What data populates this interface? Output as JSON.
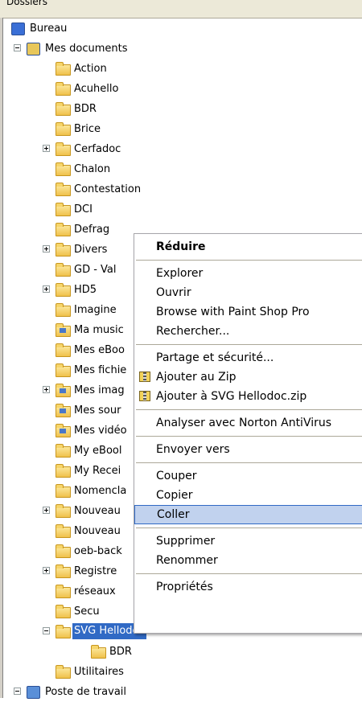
{
  "panel": {
    "title": "Dossiers"
  },
  "tree": [
    {
      "label": "Bureau",
      "icon": "desktop-icon",
      "level": 0,
      "expander": ""
    },
    {
      "label": "Mes documents",
      "icon": "my-documents-icon",
      "level": 1,
      "expander": "minus"
    },
    {
      "label": "Action",
      "icon": "folder-icon",
      "level": 2,
      "expander": ""
    },
    {
      "label": "Acuhello",
      "icon": "folder-icon",
      "level": 2,
      "expander": ""
    },
    {
      "label": "BDR",
      "icon": "folder-icon",
      "level": 2,
      "expander": ""
    },
    {
      "label": "Brice",
      "icon": "folder-icon",
      "level": 2,
      "expander": ""
    },
    {
      "label": "Cerfadoc",
      "icon": "folder-icon",
      "level": 2,
      "expander": "plus"
    },
    {
      "label": "Chalon",
      "icon": "folder-icon",
      "level": 2,
      "expander": ""
    },
    {
      "label": "Contestation",
      "icon": "folder-icon",
      "level": 2,
      "expander": ""
    },
    {
      "label": "DCI",
      "icon": "folder-icon",
      "level": 2,
      "expander": ""
    },
    {
      "label": "Defrag",
      "icon": "folder-icon",
      "level": 2,
      "expander": ""
    },
    {
      "label": "Divers",
      "icon": "folder-icon",
      "level": 2,
      "expander": "plus"
    },
    {
      "label": "GD - Val",
      "icon": "folder-icon",
      "level": 2,
      "expander": ""
    },
    {
      "label": "HD5",
      "icon": "folder-icon",
      "level": 2,
      "expander": "plus"
    },
    {
      "label": "Imagine",
      "icon": "folder-icon",
      "level": 2,
      "expander": ""
    },
    {
      "label": "Ma music",
      "icon": "music-folder-icon",
      "level": 2,
      "expander": ""
    },
    {
      "label": "Mes eBoo",
      "icon": "folder-icon",
      "level": 2,
      "expander": ""
    },
    {
      "label": "Mes fichie",
      "icon": "folder-icon",
      "level": 2,
      "expander": ""
    },
    {
      "label": "Mes imag",
      "icon": "pictures-folder-icon",
      "level": 2,
      "expander": "plus"
    },
    {
      "label": "Mes sour",
      "icon": "sources-folder-icon",
      "level": 2,
      "expander": ""
    },
    {
      "label": "Mes vidéo",
      "icon": "videos-folder-icon",
      "level": 2,
      "expander": ""
    },
    {
      "label": "My eBool",
      "icon": "folder-icon",
      "level": 2,
      "expander": ""
    },
    {
      "label": "My Recei",
      "icon": "folder-icon",
      "level": 2,
      "expander": ""
    },
    {
      "label": "Nomencla",
      "icon": "folder-icon",
      "level": 2,
      "expander": ""
    },
    {
      "label": "Nouveau",
      "icon": "folder-icon",
      "level": 2,
      "expander": "plus"
    },
    {
      "label": "Nouveau",
      "icon": "folder-icon",
      "level": 2,
      "expander": ""
    },
    {
      "label": "oeb-back",
      "icon": "folder-icon",
      "level": 2,
      "expander": ""
    },
    {
      "label": "Registre",
      "icon": "folder-icon",
      "level": 2,
      "expander": "plus"
    },
    {
      "label": "réseaux",
      "icon": "folder-icon",
      "level": 2,
      "expander": ""
    },
    {
      "label": "Secu",
      "icon": "folder-icon",
      "level": 2,
      "expander": ""
    },
    {
      "label": "SVG Hellodoc",
      "icon": "folder-open-icon",
      "level": 2,
      "expander": "minus",
      "selected": true
    },
    {
      "label": "BDR",
      "icon": "folder-icon",
      "level": 3,
      "expander": ""
    },
    {
      "label": "Utilitaires",
      "icon": "folder-icon",
      "level": 2,
      "expander": ""
    },
    {
      "label": "Poste de travail",
      "icon": "my-computer-icon",
      "level": 1,
      "expander": "minus"
    }
  ],
  "context_menu": {
    "groups": [
      [
        {
          "label": "Réduire",
          "bold": true
        }
      ],
      [
        {
          "label": "Explorer"
        },
        {
          "label": "Ouvrir"
        },
        {
          "label": "Browse with Paint Shop Pro"
        },
        {
          "label": "Rechercher..."
        }
      ],
      [
        {
          "label": "Partage et sécurité..."
        },
        {
          "label": "Ajouter au Zip",
          "icon": "zip-icon"
        },
        {
          "label": "Ajouter à SVG Hellodoc.zip",
          "icon": "zip-icon"
        }
      ],
      [
        {
          "label": "Analyser avec Norton AntiVirus"
        }
      ],
      [
        {
          "label": "Envoyer vers"
        }
      ],
      [
        {
          "label": "Couper"
        },
        {
          "label": "Copier"
        },
        {
          "label": "Coller",
          "highlighted": true
        }
      ],
      [
        {
          "label": "Supprimer"
        },
        {
          "label": "Renommer"
        }
      ],
      [
        {
          "label": "Propriétés"
        }
      ]
    ]
  },
  "colors": {
    "selection": "#316ac5",
    "menu_highlight": "#c1d2ee",
    "folder": "#f0c14b"
  }
}
